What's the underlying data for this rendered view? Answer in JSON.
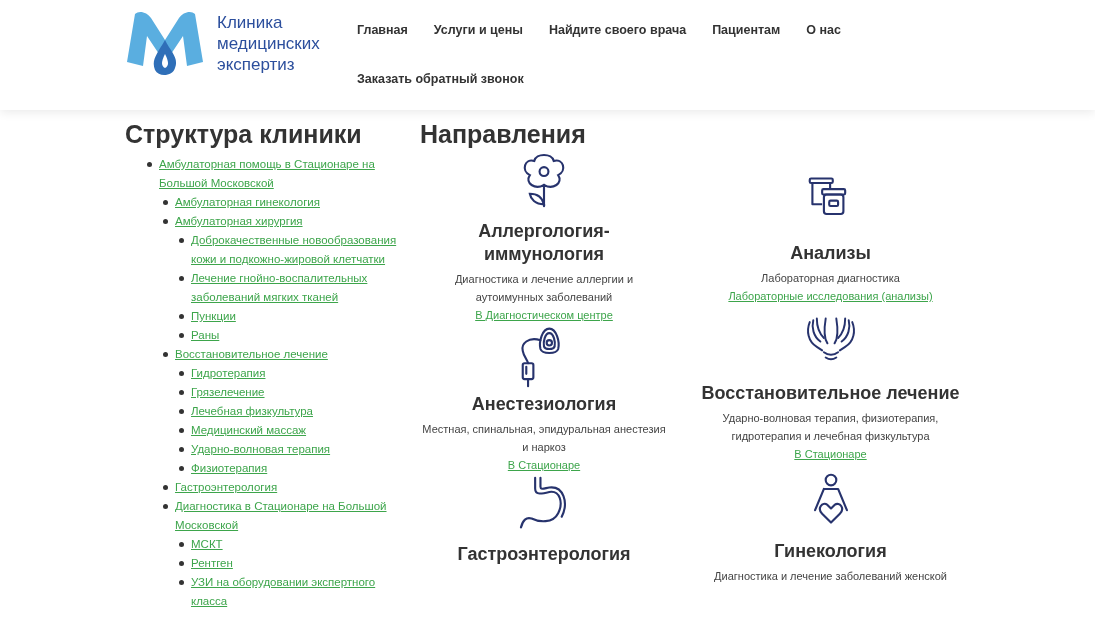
{
  "logo": {
    "lines": [
      "Клиника",
      "медицинских",
      "экспертиз"
    ]
  },
  "nav": [
    {
      "label": "Главная"
    },
    {
      "label": "Услуги и цены"
    },
    {
      "label": "Найдите своего врача"
    },
    {
      "label": "Пациентам"
    },
    {
      "label": "О нас"
    },
    {
      "label": "Заказать обратный звонок"
    }
  ],
  "structure": {
    "title": "Структура клиники",
    "items": [
      {
        "label": "Амбулаторная помощь в Стационаре на Большой Московской",
        "children": [
          {
            "label": "Амбулаторная гинекология"
          },
          {
            "label": "Амбулаторная хирургия",
            "children": [
              {
                "label": "Доброкачественные новообразования кожи и подкожно-жировой клетчатки"
              },
              {
                "label": "Лечение гнойно-воспалительных заболеваний мягких тканей"
              },
              {
                "label": "Пункции"
              },
              {
                "label": "Раны"
              }
            ]
          },
          {
            "label": "Восстановительное лечение",
            "children": [
              {
                "label": "Гидротерапия"
              },
              {
                "label": "Грязелечение"
              },
              {
                "label": "Лечебная физкультура"
              },
              {
                "label": "Медицинский массаж"
              },
              {
                "label": "Ударно-волновая терапия"
              },
              {
                "label": "Физиотерапия"
              }
            ]
          },
          {
            "label": "Гастроэнтерология"
          },
          {
            "label": "Диагностика в Стационаре на Большой Московской",
            "children": [
              {
                "label": "МСКТ"
              },
              {
                "label": "Рентген"
              },
              {
                "label": "УЗИ на оборудовании экспертного класса"
              }
            ]
          }
        ]
      }
    ]
  },
  "directions": {
    "title": "Направления",
    "columns": [
      [
        {
          "kind": "flower",
          "title": "Аллергология-иммунология",
          "description": "Диагностика и лечение аллергии и аутоимунных заболеваний",
          "link": "В Диагностическом центре"
        },
        {
          "kind": "mask",
          "title": "Анестезиология",
          "description": "Местная, спинальная, эпидуральная анестезия и наркоз",
          "link": "В Стационаре"
        },
        {
          "kind": "stomach",
          "title": "Гастроэнтерология"
        }
      ],
      [
        {
          "kind": "jars",
          "title": "Анализы",
          "description": "Лабораторная диагностика",
          "link": "Лабораторные исследования (анализы)"
        },
        {
          "kind": "hands",
          "title": "Восстановительное лечение",
          "description": "Ударно-волновая терапия, физиотерапия, гидротерапия и лечебная физкультура",
          "link": "В Стационаре"
        },
        {
          "kind": "pregnant",
          "title": "Гинекология",
          "description": "Диагностика и лечение заболеваний женской"
        }
      ]
    ]
  }
}
